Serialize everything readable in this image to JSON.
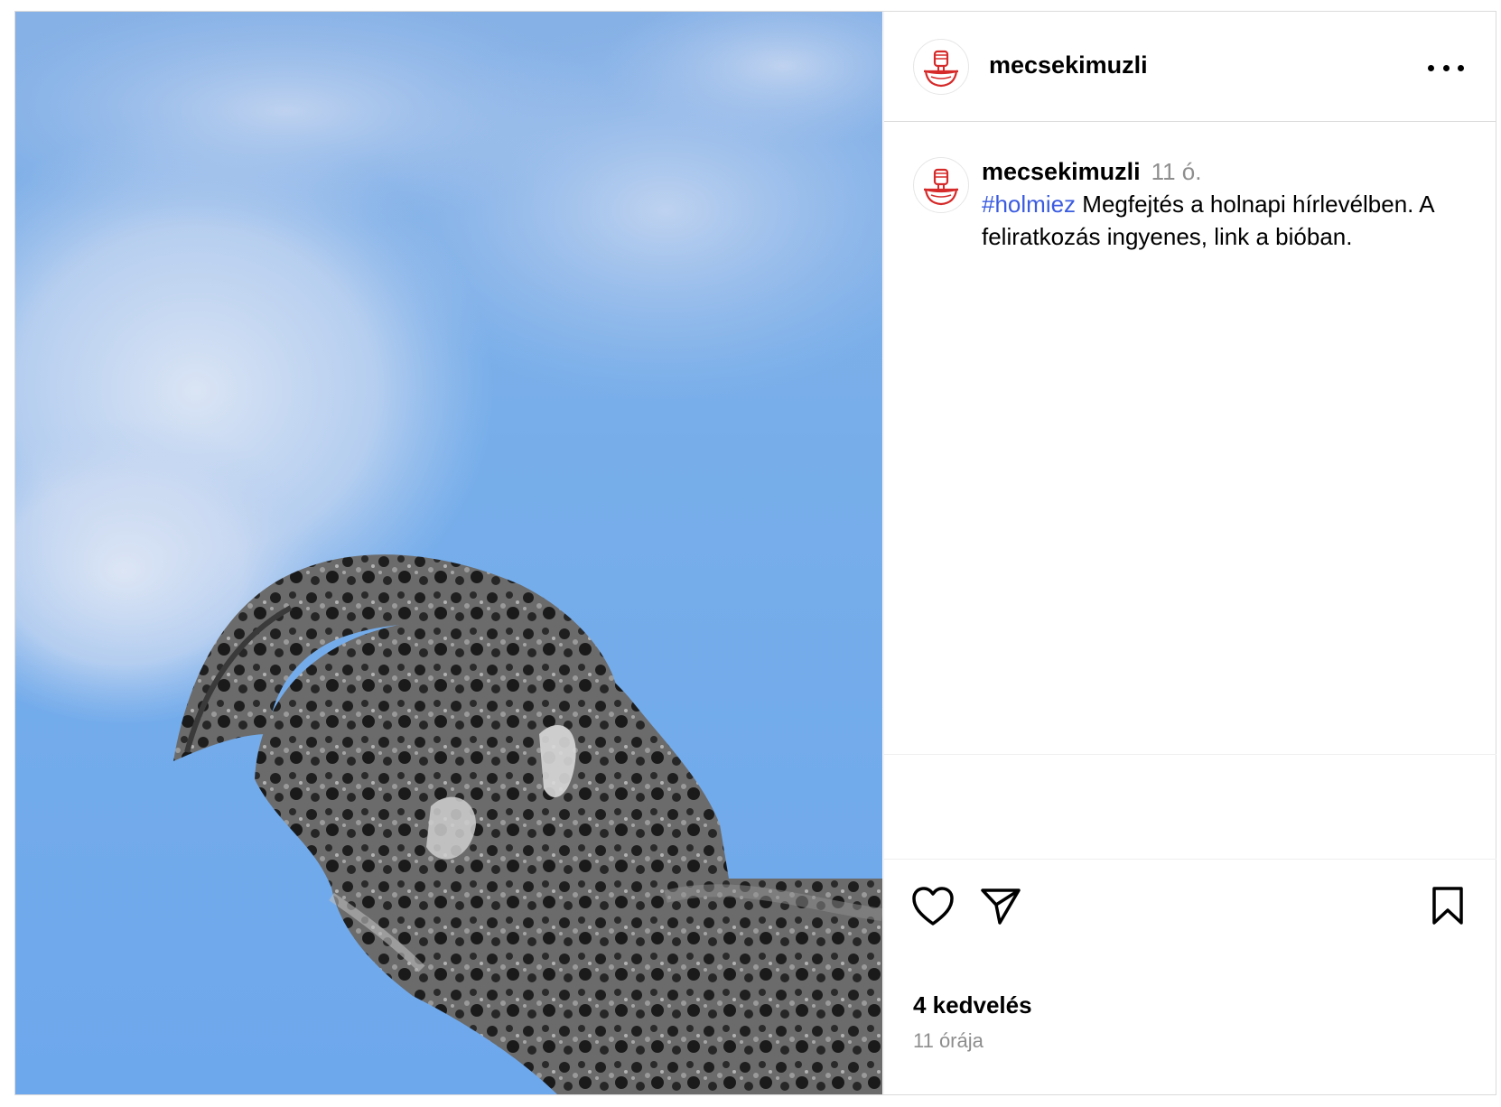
{
  "post": {
    "username": "mecsekimuzli",
    "header_username": "mecsekimuzli",
    "caption": {
      "username": "mecsekimuzli",
      "time_short": "11 ó.",
      "hashtag": "#holmiez",
      "text": " Megfejtés a holnapi hírlevélben. A feliratkozás ingyenes, link a bióban."
    },
    "likes": "4 kedvelés",
    "time_ago": "11 órája"
  },
  "icons": {
    "avatar": "logo-fist-bowl-icon",
    "more": "more-options-icon",
    "like": "heart-icon",
    "share": "send-icon",
    "save": "bookmark-icon"
  },
  "colors": {
    "accent_link": "#3b5ce0",
    "logo_red": "#d62a2a",
    "muted": "#8e8e8e",
    "border": "#dbdbdb",
    "sky": "#6ea8ec"
  }
}
